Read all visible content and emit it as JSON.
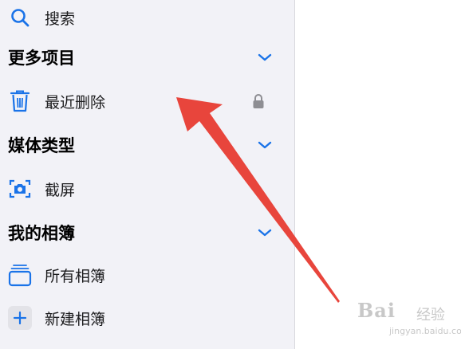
{
  "sidebar": {
    "search_label": "搜索",
    "sections": {
      "more": {
        "title": "更多项目",
        "items": {
          "recently_deleted": "最近删除"
        }
      },
      "media_types": {
        "title": "媒体类型",
        "items": {
          "screenshots": "截屏"
        }
      },
      "my_albums": {
        "title": "我的相簿",
        "items": {
          "all_albums": "所有相簿",
          "new_album": "新建相簿"
        }
      }
    }
  },
  "watermark": {
    "logo": "Bai",
    "text": "经验",
    "url": "jingyan.baidu.com"
  },
  "colors": {
    "accent": "#1a73e8",
    "sidebar_bg": "#f2f2f7",
    "arrow": "#e8453c",
    "lock": "#8e8e93"
  }
}
